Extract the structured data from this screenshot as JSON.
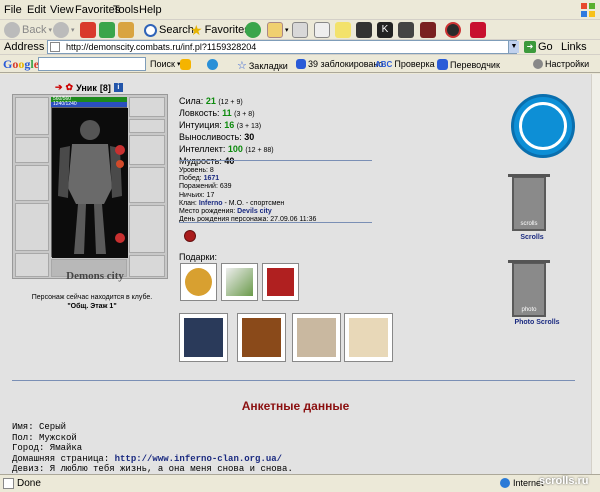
{
  "menubar": {
    "items": [
      "File",
      "Edit",
      "View",
      "Favorites",
      "Tools",
      "Help"
    ]
  },
  "toolbar": {
    "back": "Back",
    "search": "Search",
    "favorites": "Favorites"
  },
  "address": {
    "label": "Address",
    "url": "http://demonscity.combats.ru/inf.pl?1159328204",
    "go": "Go",
    "links": "Links"
  },
  "googlebar": {
    "logo": "Google",
    "items": [
      "Поиск",
      "Закладки",
      "39 заблокировано",
      "Проверка",
      "Переводчик",
      "Настройки"
    ]
  },
  "character": {
    "name": "Уник",
    "level": "[8]",
    "hp": "560/560",
    "mp": "1240/1240",
    "city": "Demons city",
    "location_text": "Персонаж сейчас находится в клубе.",
    "room": "\"Общ. Этаж 1\""
  },
  "stats": [
    {
      "label": "Сила:",
      "value": "21",
      "extra": "(12 + 9)"
    },
    {
      "label": "Ловкость:",
      "value": "11",
      "extra": "(3 + 8)"
    },
    {
      "label": "Интуиция:",
      "value": "16",
      "extra": "(3 + 13)"
    },
    {
      "label": "Выносливость:",
      "value": "30",
      "extra": ""
    },
    {
      "label": "Интеллект:",
      "value": "100",
      "extra": "(12 + 88)"
    },
    {
      "label": "Мудрость:",
      "value": "40",
      "extra": ""
    }
  ],
  "info": {
    "level": "Уровень: 8",
    "wins_label": "Побед:",
    "wins": "1671",
    "losses": "Поражений: 639",
    "draws": "Ничьих: 17",
    "clan_label": "Клан:",
    "clan": "Inferno",
    "clan_rank": "- М.О. - спортсмен",
    "birthplace_label": "Место рождения:",
    "birthplace": "Devils city",
    "birthday": "День рождения персонажа: 27.09.06 11:36"
  },
  "gifts_label": "Подарки:",
  "logos": {
    "scrolls": "Scrolls",
    "photo_scrolls": "Photo Scrolls",
    "scrolls_badge": "scrolls",
    "photo_badge": "photo"
  },
  "profile": {
    "title": "Анкетные данные",
    "name": "Имя: Серый",
    "sex": "Пол: Мужской",
    "city": "Город: Ямайка",
    "homepage_label": "Домашняя страница:",
    "homepage": "http://www.inferno-clan.org.ua/",
    "motto": "Девиз: Я люблю тебя жизнь, а она меня снова и снова."
  },
  "status": {
    "text": "Done",
    "zone": "Internet",
    "watermark": "scrolls.ru"
  }
}
